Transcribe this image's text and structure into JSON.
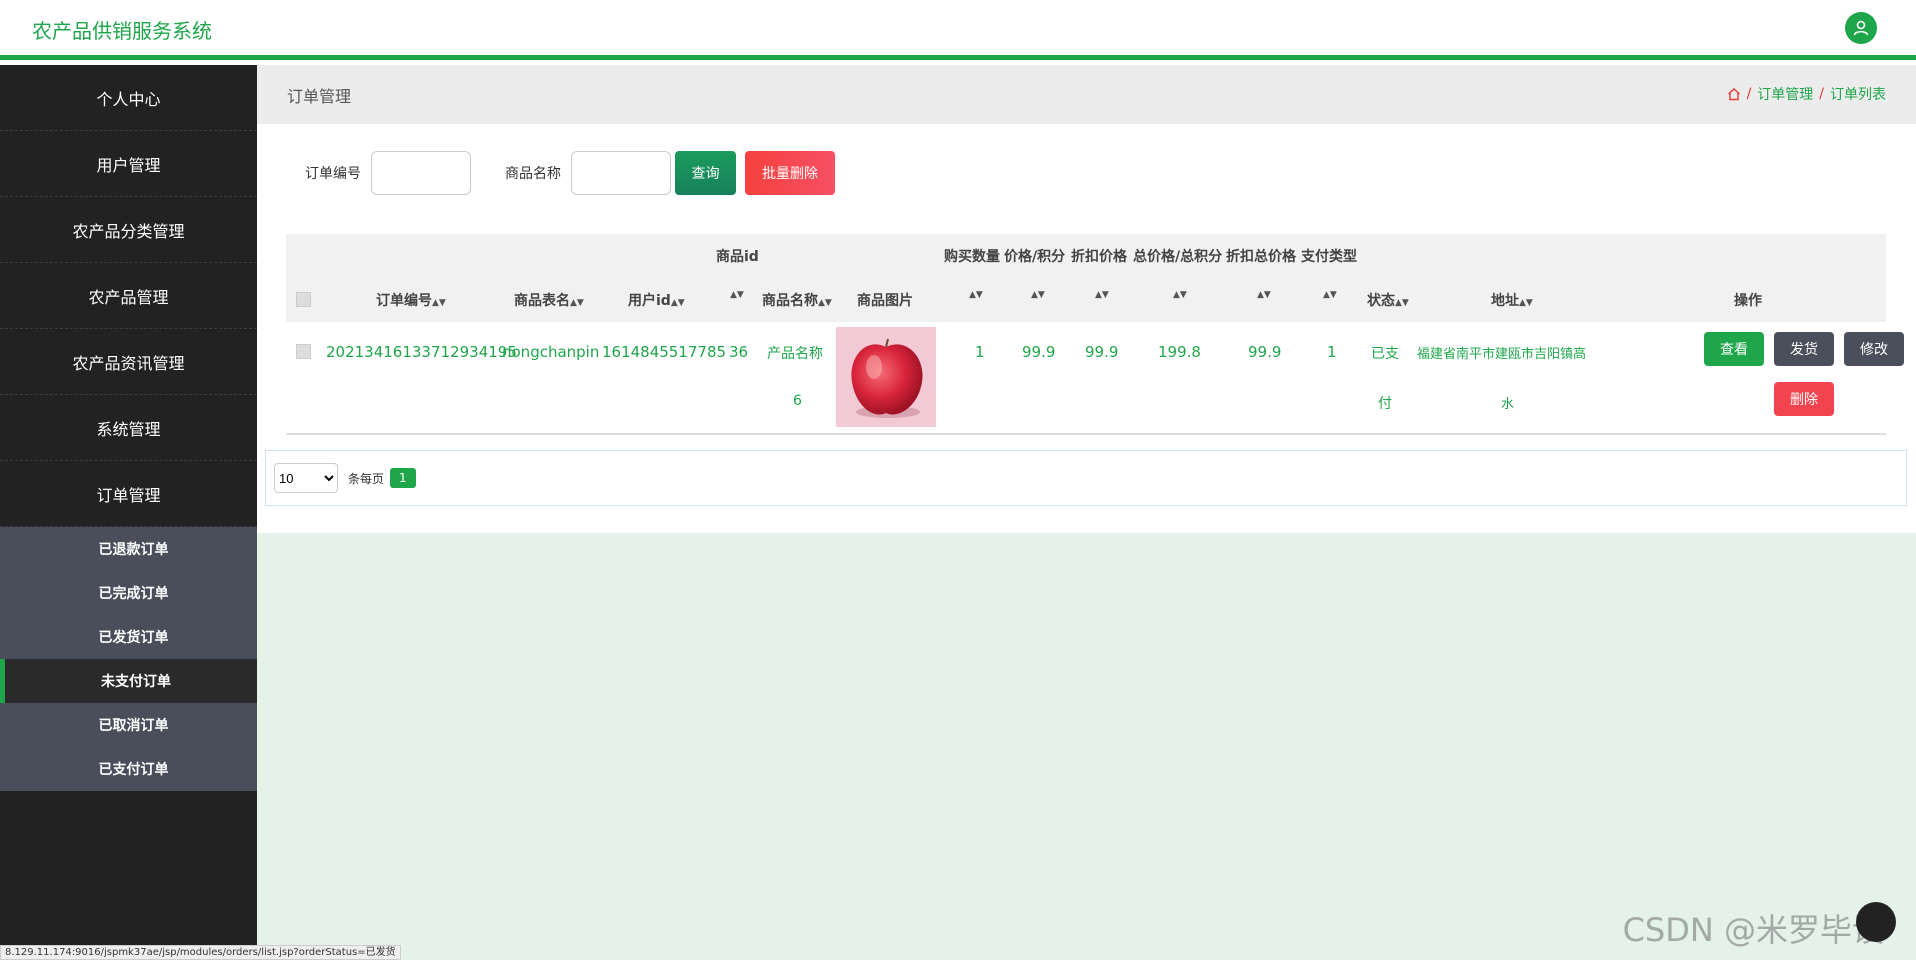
{
  "header": {
    "title": "农产品供销服务系统",
    "avatar_icon": "user-icon"
  },
  "sidebar": {
    "menu": [
      {
        "label": "个人中心"
      },
      {
        "label": "用户管理"
      },
      {
        "label": "农产品分类管理"
      },
      {
        "label": "农产品管理"
      },
      {
        "label": "农产品资讯管理"
      },
      {
        "label": "系统管理"
      },
      {
        "label": "订单管理"
      }
    ],
    "submenu": [
      {
        "label": "已退款订单"
      },
      {
        "label": "已完成订单"
      },
      {
        "label": "已发货订单"
      },
      {
        "label": "未支付订单"
      },
      {
        "label": "已取消订单"
      },
      {
        "label": "已支付订单"
      }
    ]
  },
  "page": {
    "title": "订单管理",
    "breadcrumb": [
      "订单管理",
      "订单列表"
    ]
  },
  "search": {
    "order_no_label": "订单编号",
    "order_no_value": "",
    "product_label": "商品名称",
    "product_value": "",
    "query_button": "查询",
    "bulk_delete_button": "批量删除"
  },
  "table": {
    "header_top": {
      "product_id": "商品id",
      "buy_qty": "购买数量",
      "price": "价格/积分",
      "discount_price": "折扣价格",
      "total": "总价格/总积分",
      "discount_total": "折扣总价格",
      "pay_type": "支付类型"
    },
    "header_bottom": {
      "order_no": "订单编号",
      "table_name": "商品表名",
      "user_id": "用户id",
      "product_name": "商品名称",
      "product_image": "商品图片",
      "status": "状态",
      "address": "地址",
      "ops": "操作"
    },
    "rows": [
      {
        "order_no": "20213416133712934195",
        "table_name": "nongchanpin",
        "user_id": "1614845517785",
        "product_id": "36",
        "product_name_1": "产品名称",
        "product_name_2": "6",
        "buy_qty": "1",
        "price": "99.9",
        "discount_price": "99.9",
        "total": "199.8",
        "discount_total": "99.9",
        "pay_type": "1",
        "status_1": "已支",
        "status_2": "付",
        "address_1": "福建省南平市建瓯市吉阳镇高",
        "address_2": "水"
      }
    ],
    "actions": {
      "view": "查看",
      "ship": "发货",
      "edit": "修改",
      "delete": "删除"
    }
  },
  "pager": {
    "page_size": "10",
    "per_page_label": "条每页",
    "current_page": "1"
  },
  "statusbar": {
    "url": "8.129.11.174:9016/jspmk37ae/jsp/modules/orders/list.jsp?orderStatus=已发货"
  },
  "watermark": "CSDN @米罗毕设"
}
